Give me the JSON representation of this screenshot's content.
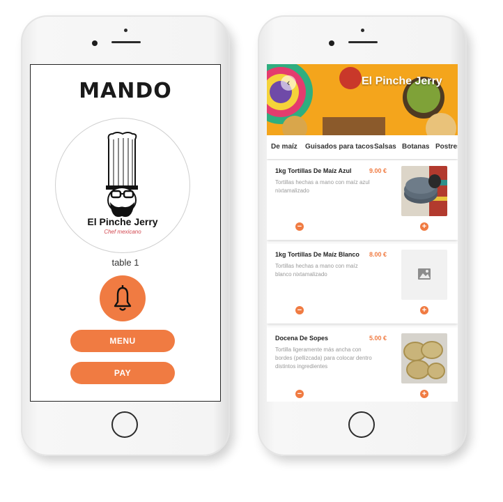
{
  "left_app": {
    "title": "MANDO",
    "brand_name": "El Pinche Jerry",
    "brand_tagline": "Chef mexicano",
    "table_label": "table 1",
    "menu_button": "MENU",
    "pay_button": "PAY"
  },
  "right_app": {
    "header_title": "El Pinche Jerry",
    "tabs": [
      "De maíz",
      "Guisados para tacos",
      "Salsas",
      "Botanas",
      "Postres"
    ],
    "items": [
      {
        "name": "1kg Tortillas De Maíz Azul",
        "price": "9.00 €",
        "description": "Tortillas hechas a mano con maíz azul nixtamalizado"
      },
      {
        "name": "1kg Tortillas De Maíz Blanco",
        "price": "8.00 €",
        "description": "Tortillas hechas a mano con maíz blanco nixtamalizado"
      },
      {
        "name": "Docena De Sopes",
        "price": "5.00 €",
        "description": "Tortilla ligeramente más ancha con bordes (pellizcada) para colocar dentro distintos ingredientes"
      }
    ],
    "minus_symbol": "−",
    "plus_symbol": "+"
  },
  "colors": {
    "accent": "#f07b42",
    "price": "#f07b42"
  }
}
